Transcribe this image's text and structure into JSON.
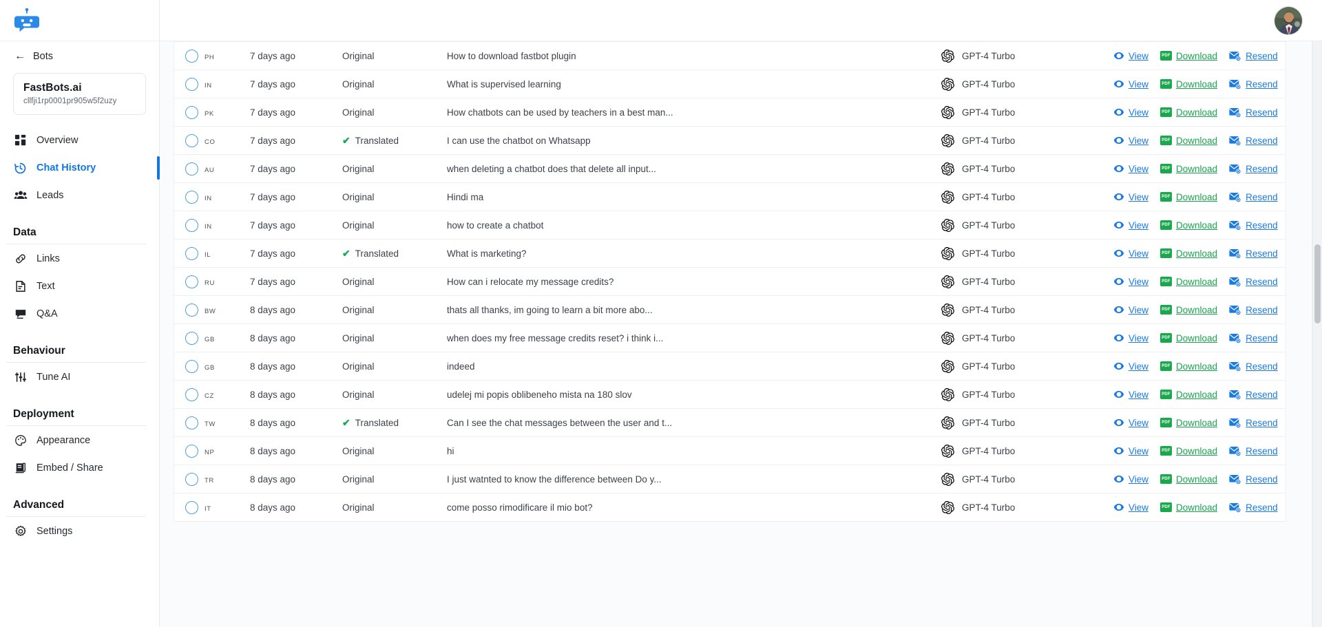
{
  "sidebar": {
    "logo_icon": "fastbots-robot-logo",
    "back_label": "Bots",
    "bot": {
      "name": "FastBots.ai",
      "id": "cllfji1rp0001pr905w5f2uzy"
    },
    "primary_items": [
      {
        "label": "Overview",
        "icon": "dashboard-icon",
        "active": false
      },
      {
        "label": "Chat History",
        "icon": "history-clock-icon",
        "active": true
      },
      {
        "label": "Leads",
        "icon": "people-icon",
        "active": false
      }
    ],
    "groups": [
      {
        "title": "Data",
        "items": [
          {
            "label": "Links",
            "icon": "link-icon"
          },
          {
            "label": "Text",
            "icon": "document-icon"
          },
          {
            "label": "Q&A",
            "icon": "chat-bubble-icon"
          }
        ]
      },
      {
        "title": "Behaviour",
        "items": [
          {
            "label": "Tune AI",
            "icon": "sliders-icon"
          }
        ]
      },
      {
        "title": "Deployment",
        "items": [
          {
            "label": "Appearance",
            "icon": "palette-icon"
          },
          {
            "label": "Embed / Share",
            "icon": "embed-icon"
          }
        ]
      },
      {
        "title": "Advanced",
        "items": [
          {
            "label": "Settings",
            "icon": "gear-icon"
          }
        ]
      }
    ]
  },
  "topbar": {
    "avatar_icon": "user-avatar-photo"
  },
  "actions": {
    "view_label": "View",
    "download_label": "Download",
    "resend_label": "Resend",
    "pdf_badge": "PDF",
    "view_icon": "eye-icon",
    "download_icon": "pdf-file-icon",
    "resend_icon": "envelope-resend-icon"
  },
  "status": {
    "original": "Original",
    "translated": "Translated",
    "tick": "✔"
  },
  "colors": {
    "accent": "#1277e0",
    "link_blue": "#1a7ae0",
    "link_green": "#17a44c",
    "tick_green": "#18a957",
    "pdf_green": "#1aa84c",
    "row_border": "#edeff1"
  },
  "table": {
    "rows": [
      {
        "country": "PH",
        "date": "7 days ago",
        "status": "Original",
        "translated": false,
        "message": "How to download fastbot plugin",
        "model": "GPT-4 Turbo"
      },
      {
        "country": "IN",
        "date": "7 days ago",
        "status": "Original",
        "translated": false,
        "message": "What is supervised learning",
        "model": "GPT-4 Turbo"
      },
      {
        "country": "PK",
        "date": "7 days ago",
        "status": "Original",
        "translated": false,
        "message": "How chatbots can be used by teachers in a best man...",
        "model": "GPT-4 Turbo"
      },
      {
        "country": "CO",
        "date": "7 days ago",
        "status": "Translated",
        "translated": true,
        "message": "I can use the chatbot on Whatsapp",
        "model": "GPT-4 Turbo"
      },
      {
        "country": "AU",
        "date": "7 days ago",
        "status": "Original",
        "translated": false,
        "message": "when deleting a chatbot does that delete all input...",
        "model": "GPT-4 Turbo"
      },
      {
        "country": "IN",
        "date": "7 days ago",
        "status": "Original",
        "translated": false,
        "message": "Hindi ma",
        "model": "GPT-4 Turbo"
      },
      {
        "country": "IN",
        "date": "7 days ago",
        "status": "Original",
        "translated": false,
        "message": "how to create a chatbot",
        "model": "GPT-4 Turbo"
      },
      {
        "country": "IL",
        "date": "7 days ago",
        "status": "Translated",
        "translated": true,
        "message": "What is marketing?",
        "model": "GPT-4 Turbo"
      },
      {
        "country": "RU",
        "date": "7 days ago",
        "status": "Original",
        "translated": false,
        "message": "How can i relocate my message credits?",
        "model": "GPT-4 Turbo"
      },
      {
        "country": "BW",
        "date": "8 days ago",
        "status": "Original",
        "translated": false,
        "message": "thats all thanks, im going to learn a bit more abo...",
        "model": "GPT-4 Turbo"
      },
      {
        "country": "GB",
        "date": "8 days ago",
        "status": "Original",
        "translated": false,
        "message": "when does my free message credits reset? i think i...",
        "model": "GPT-4 Turbo"
      },
      {
        "country": "GB",
        "date": "8 days ago",
        "status": "Original",
        "translated": false,
        "message": "indeed",
        "model": "GPT-4 Turbo"
      },
      {
        "country": "CZ",
        "date": "8 days ago",
        "status": "Original",
        "translated": false,
        "message": "udelej mi popis oblibeneho mista na 180 slov",
        "model": "GPT-4 Turbo"
      },
      {
        "country": "TW",
        "date": "8 days ago",
        "status": "Translated",
        "translated": true,
        "message": "Can I see the chat messages between the user and t...",
        "model": "GPT-4 Turbo"
      },
      {
        "country": "NP",
        "date": "8 days ago",
        "status": "Original",
        "translated": false,
        "message": "hi",
        "model": "GPT-4 Turbo"
      },
      {
        "country": "TR",
        "date": "8 days ago",
        "status": "Original",
        "translated": false,
        "message": "I just watnted to know the difference between Do y...",
        "model": "GPT-4 Turbo"
      },
      {
        "country": "IT",
        "date": "8 days ago",
        "status": "Original",
        "translated": false,
        "message": "come posso rimodificare il mio bot?",
        "model": "GPT-4 Turbo"
      }
    ]
  }
}
